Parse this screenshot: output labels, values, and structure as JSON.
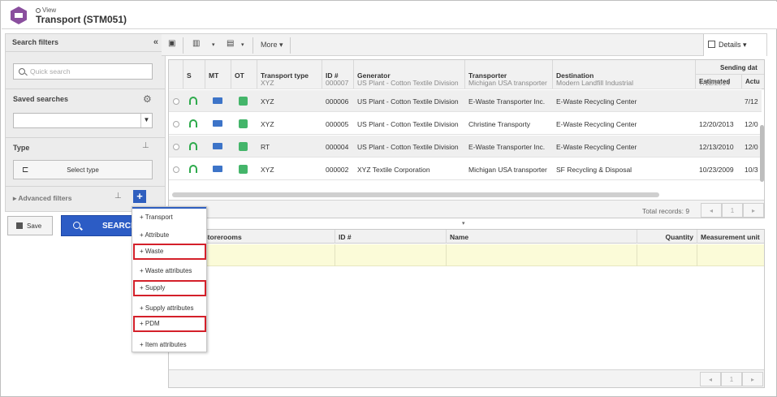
{
  "header": {
    "view_label": "View",
    "title": "Transport (STM051)"
  },
  "left_panel": {
    "search_filters": "Search filters",
    "quick_search_placeholder": "Quick search",
    "saved_searches": "Saved searches",
    "type_label": "Type",
    "select_type": "Select type",
    "advanced_filters": "Advanced filters",
    "save": "Save",
    "search": "SEARCH"
  },
  "menu": {
    "items": [
      {
        "label": "+ Transport",
        "highlight": false
      },
      {
        "label": "+ Attribute",
        "highlight": false
      },
      {
        "label": "+ Waste",
        "highlight": true
      },
      {
        "label": "+ Waste attributes",
        "highlight": false
      },
      {
        "label": "+ Supply",
        "highlight": true
      },
      {
        "label": "+ Supply attributes",
        "highlight": false
      },
      {
        "label": "+ PDM",
        "highlight": true
      },
      {
        "label": "+ Item attributes",
        "highlight": false
      }
    ]
  },
  "toolbar": {
    "more": "More",
    "details": "Details"
  },
  "grid": {
    "headers": {
      "s": "S",
      "mt": "MT",
      "ot": "OT",
      "type": "Transport type",
      "id": "ID #",
      "generator": "Generator",
      "transporter": "Transporter",
      "destination": "Destination",
      "sending": "Sending dat",
      "estimated": "Estimated",
      "actual": "Actu"
    },
    "rows": [
      {
        "type": "XYZ",
        "id": "000007",
        "generator": "US Plant - Cotton Textile Division",
        "transporter": "Michigan USA transporter",
        "destination": "Modern Landfill Industrial",
        "estimated": "7/12/2014",
        "actual": ""
      },
      {
        "type": "XYZ",
        "id": "000006",
        "generator": "US Plant - Cotton Textile Division",
        "transporter": "E-Waste Transporter Inc.",
        "destination": "E-Waste Recycling Center",
        "estimated": "",
        "actual": "7/12"
      },
      {
        "type": "XYZ",
        "id": "000005",
        "generator": "US Plant - Cotton Textile Division",
        "transporter": "Christine Transporty",
        "destination": "E-Waste Recycling Center",
        "estimated": "12/20/2013",
        "actual": "12/0"
      },
      {
        "type": "RT",
        "id": "000004",
        "generator": "US Plant - Cotton Textile Division",
        "transporter": "E-Waste Transporter Inc.",
        "destination": "E-Waste Recycling Center",
        "estimated": "12/13/2010",
        "actual": "12/0"
      },
      {
        "type": "XYZ",
        "id": "000002",
        "generator": "XYZ Textile Corporation",
        "transporter": "Michigan USA transporter",
        "destination": "SF Recycling & Disposal",
        "estimated": "10/23/2009",
        "actual": "10/3"
      }
    ],
    "total_records": "Total records: 9",
    "page": "1"
  },
  "grid2": {
    "headers": {
      "storerooms": "Storerooms",
      "id": "ID #",
      "name": "Name",
      "quantity": "Quantity",
      "unit": "Measurement unit"
    },
    "page": "1"
  }
}
